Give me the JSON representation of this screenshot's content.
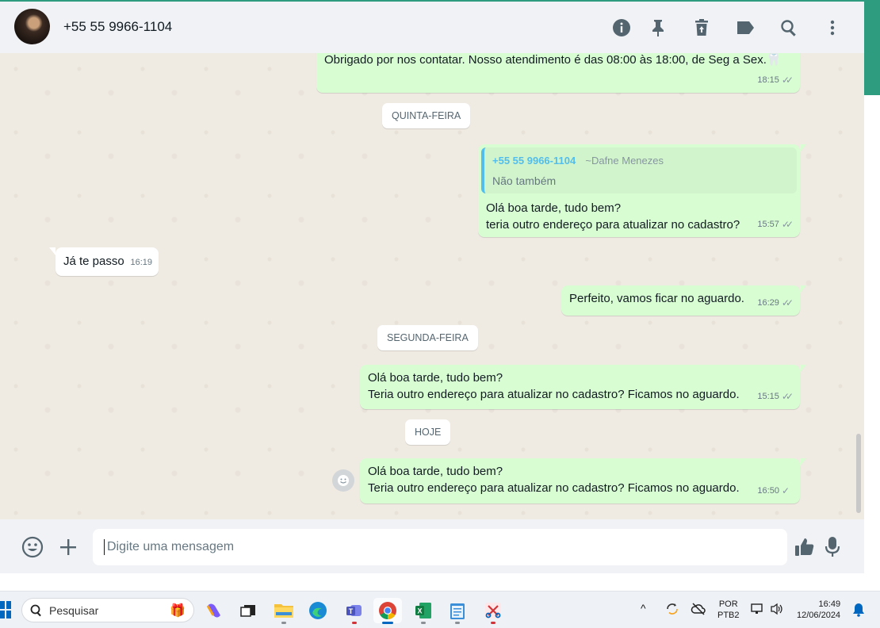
{
  "header": {
    "contact_name": "+55 55 9966-1104",
    "icons": [
      "info-icon",
      "pin-icon",
      "delete-icon",
      "label-icon",
      "search-icon",
      "more-icon"
    ]
  },
  "messages": {
    "m1": {
      "text": "Obrigado por nos contatar. Nosso atendimento é das 08:00 às 18:00, de Seg a Sex.🦷",
      "time": "18:15",
      "status": "read"
    },
    "day1": "QUINTA-FEIRA",
    "m2": {
      "quote_author": "+55 55 9966-1104",
      "quote_alias": "~Dafne Menezes",
      "quote_text": "Não também",
      "line1": "Olá boa tarde, tudo bem?",
      "line2": "teria outro endereço para atualizar no cadastro?",
      "time": "15:57",
      "status": "read"
    },
    "m3": {
      "text": "Já te passo",
      "time": "16:19"
    },
    "m4": {
      "text": "Perfeito, vamos ficar no aguardo.",
      "time": "16:29",
      "status": "read"
    },
    "day2": "SEGUNDA-FEIRA",
    "m5": {
      "line1": "Olá boa tarde, tudo bem?",
      "line2": "Teria outro endereço para atualizar no cadastro? Ficamos no aguardo.",
      "time": "15:15",
      "status": "read"
    },
    "day3": "HOJE",
    "m6": {
      "line1": "Olá boa tarde, tudo bem?",
      "line2": "Teria outro endereço para atualizar no cadastro? Ficamos no aguardo.",
      "time": "16:50",
      "status": "sent"
    }
  },
  "composer": {
    "placeholder": "Digite uma mensagem"
  },
  "taskbar": {
    "search_label": "Pesquisar",
    "language_line1": "POR",
    "language_line2": "PTB2",
    "clock_time": "16:49",
    "clock_date": "12/06/2024"
  },
  "colors": {
    "outgoing_bubble": "#d9fdd3",
    "incoming_bubble": "#ffffff",
    "chat_background": "#efeae2",
    "accent": "#2e9c7e",
    "quote_bar": "#53bdeb"
  }
}
